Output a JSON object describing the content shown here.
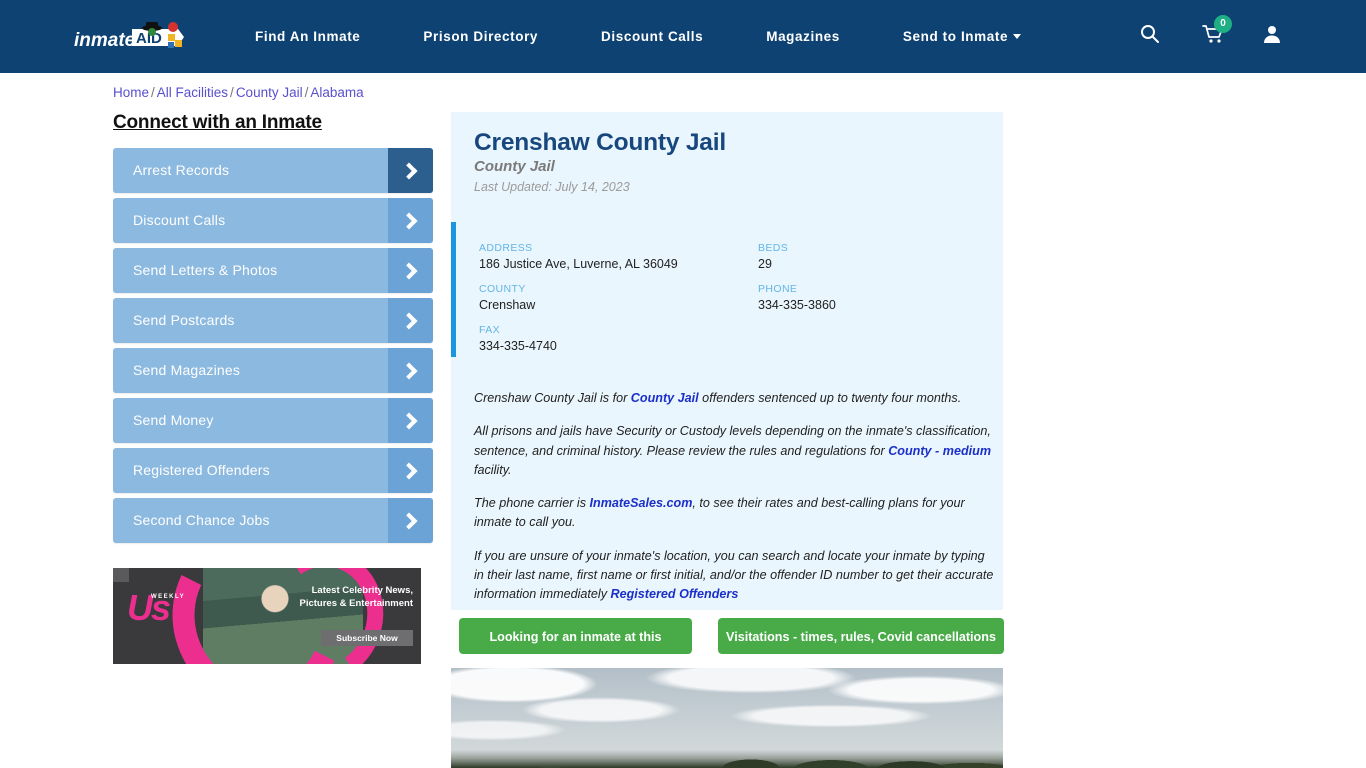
{
  "header": {
    "logo_text": "inmateAID",
    "logo_icon": "inmateaid-logo",
    "nav": [
      {
        "label": "Find An Inmate"
      },
      {
        "label": "Prison Directory"
      },
      {
        "label": "Discount Calls"
      },
      {
        "label": "Magazines"
      },
      {
        "label": "Send to Inmate"
      }
    ],
    "icons": {
      "search": "search-icon",
      "cart": "cart-icon",
      "account": "user-account-icon"
    },
    "cart_count": "0",
    "colors": {
      "header_bg": "#0e4272",
      "cart_badge": "#1eaf85"
    }
  },
  "breadcrumb": {
    "items": [
      "Home",
      "All Facilities",
      "County Jail",
      "Alabama"
    ],
    "separator": "/"
  },
  "sidebar": {
    "title": "Connect with an Inmate",
    "items": [
      {
        "label": "Arrest Records"
      },
      {
        "label": "Discount Calls"
      },
      {
        "label": "Send Letters & Photos"
      },
      {
        "label": "Send Postcards"
      },
      {
        "label": "Send Magazines"
      },
      {
        "label": "Send Money"
      },
      {
        "label": "Registered Offenders"
      },
      {
        "label": "Second Chance Jobs"
      }
    ],
    "ad": {
      "brand": "Us",
      "brand_sub": "WEEKLY",
      "headline": "Latest Celebrity News, Pictures & Entertainment",
      "cta": "Subscribe Now"
    }
  },
  "facility": {
    "name": "Crenshaw County Jail",
    "type": "County Jail",
    "last_updated": "Last Updated: July 14, 2023",
    "info": {
      "address_label": "ADDRESS",
      "address_value": "186 Justice Ave, Luverne, AL 36049",
      "county_label": "COUNTY",
      "county_value": "Crenshaw",
      "fax_label": "FAX",
      "fax_value": "334-335-4740",
      "beds_label": "BEDS",
      "beds_value": "29",
      "phone_label": "PHONE",
      "phone_value": "334-335-3860"
    },
    "description": {
      "p1_a": "Crenshaw County Jail is for ",
      "p1_link": "County Jail",
      "p1_b": " offenders sentenced up to twenty four months.",
      "p2_a": "All prisons and jails have Security or Custody levels depending on the inmate's classification, sentence, and criminal history. Please review the rules and regulations for ",
      "p2_link": "County - medium",
      "p2_b": " facility.",
      "p3_a": "The phone carrier is ",
      "p3_link": "InmateSales.com",
      "p3_b": ", to see their rates and best-calling plans for your inmate to call you.",
      "p4_a": "If you are unsure of your inmate's location, you can search and locate your inmate by typing in their last name, first name or first initial, and/or the offender ID number to get their accurate information immediately ",
      "p4_link": "Registered Offenders"
    },
    "actions": {
      "find_inmate": "Looking for an inmate at this facility?",
      "visitations": "Visitations - times, rules, Covid cancellations"
    },
    "photo_alt": "facility-exterior-photo"
  }
}
